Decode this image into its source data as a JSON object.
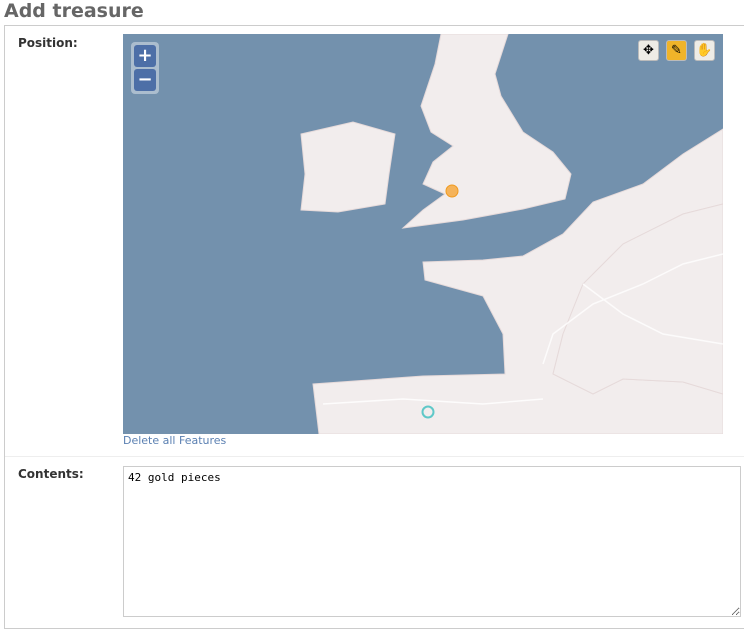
{
  "title": "Add treasure",
  "position": {
    "label": "Position:",
    "delete_link": "Delete all Features",
    "zoom_in": "+",
    "zoom_out": "−",
    "tools": [
      {
        "name": "navigate",
        "icon": "move-icon",
        "glyph": "✥"
      },
      {
        "name": "draw-point",
        "icon": "pencil-icon",
        "glyph": "✎",
        "active": true
      },
      {
        "name": "pan",
        "icon": "hand-icon",
        "glyph": "✋"
      }
    ],
    "colors": {
      "sea": "#7391ad",
      "land": "#f2eded",
      "active_tool": "#f0b429",
      "feature": "#f5b35a",
      "vertex": "#5fc8c8"
    }
  },
  "contents": {
    "label": "Contents:",
    "value": "42 gold pieces"
  }
}
